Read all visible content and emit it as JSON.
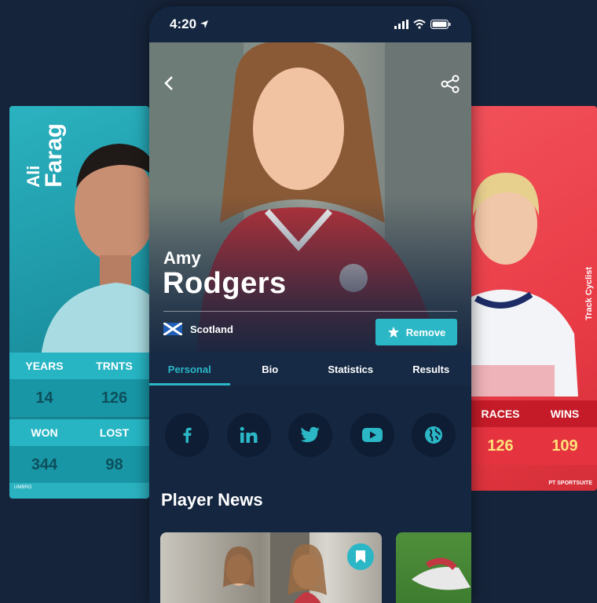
{
  "status_bar": {
    "time": "4:20"
  },
  "left_card": {
    "first_name": "Ali",
    "last_name": "Farag",
    "stats": [
      {
        "label": "YEARS",
        "value": "14"
      },
      {
        "label": "TRNTS",
        "value": "126"
      },
      {
        "label": "WON",
        "value": "344"
      },
      {
        "label": "LOST",
        "value": "98"
      }
    ],
    "brand": "UMBRO"
  },
  "right_card": {
    "role": "Track Cyclist",
    "stats": [
      {
        "label": "RACES",
        "value": "126"
      },
      {
        "label": "WINS",
        "value": "109"
      }
    ],
    "brand": "PT SPORTSUITE"
  },
  "player": {
    "first_name": "Amy",
    "last_name": "Rodgers",
    "country": "Scotland",
    "remove_label": "Remove"
  },
  "tabs": [
    {
      "label": "Personal",
      "active": true
    },
    {
      "label": "Bio"
    },
    {
      "label": "Statistics"
    },
    {
      "label": "Results"
    }
  ],
  "socials": [
    "facebook-icon",
    "linkedin-icon",
    "twitter-icon",
    "youtube-icon",
    "globe-icon"
  ],
  "news": {
    "title": "Player News"
  },
  "colors": {
    "accent": "#2bb7c6",
    "background": "#16243b",
    "circle": "#ee5f5f",
    "right_card": "#e83b46"
  }
}
